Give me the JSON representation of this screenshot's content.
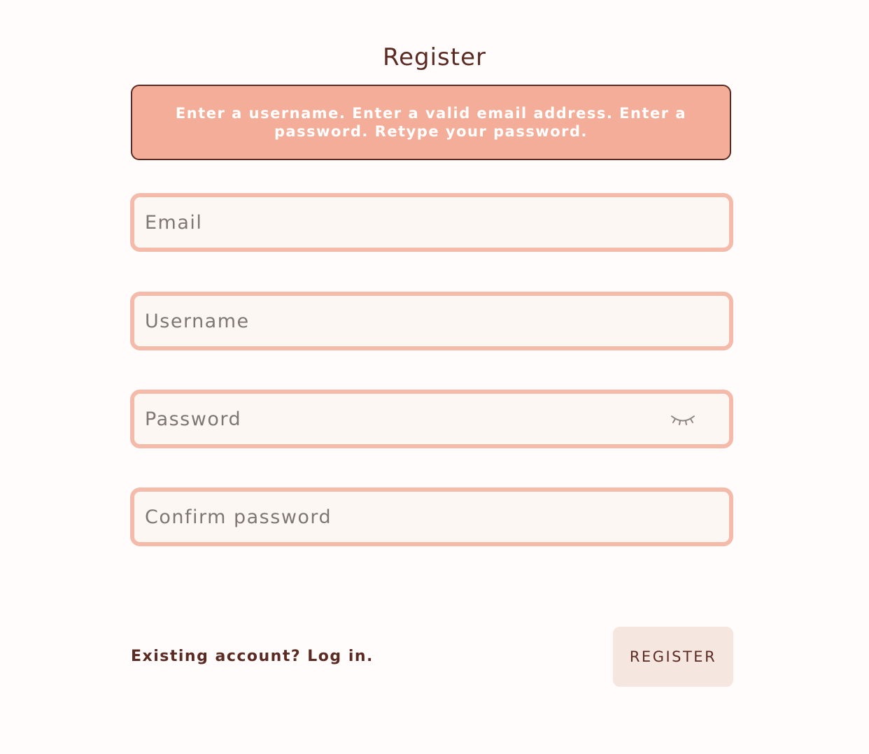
{
  "page": {
    "title": "Register"
  },
  "error": {
    "message": "Enter a username. Enter a valid email address. Enter a password. Retype your password."
  },
  "fields": {
    "email": {
      "placeholder": "Email",
      "value": ""
    },
    "username": {
      "placeholder": "Username",
      "value": ""
    },
    "password": {
      "placeholder": "Password",
      "value": "",
      "toggle_icon": "eye-closed-icon"
    },
    "confirm_password": {
      "placeholder": "Confirm password",
      "value": ""
    }
  },
  "footer": {
    "login_link": "Existing account? Log in.",
    "register_label": "REGISTER"
  },
  "colors": {
    "background": "#fffcfb",
    "error_background": "#f4ad98",
    "field_border": "#f4bbab",
    "text": "#5b2a22",
    "button_background": "#f5e6df"
  }
}
